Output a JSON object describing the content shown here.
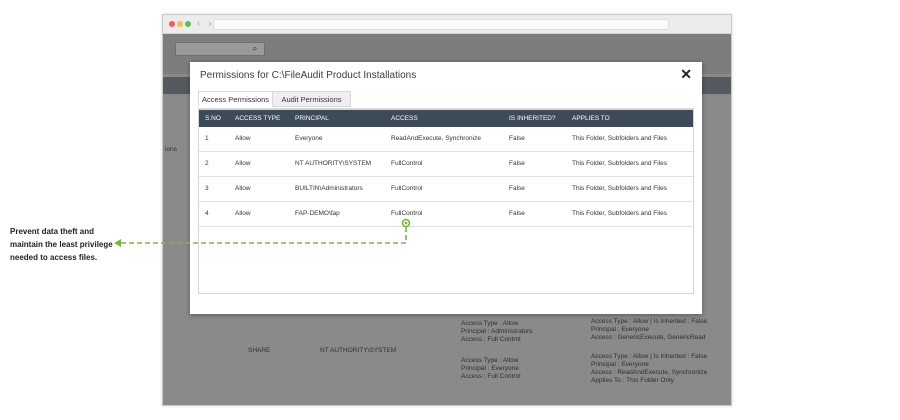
{
  "modal": {
    "title": "Permissions for C:\\FileAudit Product Installations",
    "close_glyph": "✕",
    "tabs": [
      {
        "label": "Access Permissions",
        "active": true
      },
      {
        "label": "Audit Permissions",
        "active": false
      }
    ],
    "columns": [
      "S.NO",
      "ACCESS TYPE",
      "PRINCIPAL",
      "ACCESS",
      "IS INHERITED?",
      "APPLIES TO"
    ],
    "rows": [
      {
        "sno": "1",
        "type": "Allow",
        "principal": "Everyone",
        "access": "ReadAndExecute, Synchronize",
        "inherited": "False",
        "applies": "This Folder, Subfolders and Files"
      },
      {
        "sno": "2",
        "type": "Allow",
        "principal": "NT AUTHORITY\\SYSTEM",
        "access": "FullControl",
        "inherited": "False",
        "applies": "This Folder, Subfolders and Files"
      },
      {
        "sno": "3",
        "type": "Allow",
        "principal": "BUILTIN\\Administrators",
        "access": "FullControl",
        "inherited": "False",
        "applies": "This Folder, Subfolders and Files"
      },
      {
        "sno": "4",
        "type": "Allow",
        "principal": "FAP-DEMO\\fap",
        "access": "FullControl",
        "inherited": "False",
        "applies": "This Folder, Subfolders and Files"
      }
    ]
  },
  "callout": {
    "line1": "Prevent data theft and",
    "line2": "maintain the least privilege",
    "line3": "needed to access files.",
    "color": "#7cb342"
  },
  "background": {
    "left_fragment": "ions",
    "right_fragments": [
      ": ..."
    ],
    "share_label": "SHARE",
    "share_principal": "NT AUTHORITY\\SYSTEM",
    "access_blocks": [
      [
        "Access Type : Allow",
        "Principal : Administrators",
        "Access : Full Control"
      ],
      [
        "Access Type : Allow",
        "Principal : Everyone",
        "Access : Full Control"
      ]
    ],
    "right_blocks": [
      [
        "Access Type : Allow | Is Inherited : False",
        "Principal : Everyone",
        "Access : GenericExecute, GenericRead"
      ],
      [
        "Access Type : Allow | Is Inherited : False",
        "Principal : Everyone",
        "Access : ReadAndExecute, Synchronize",
        "Applies To : This Folder Only"
      ]
    ]
  },
  "icons": {
    "search": "search-icon",
    "close": "close-icon",
    "pointer": "target-dot-icon"
  }
}
